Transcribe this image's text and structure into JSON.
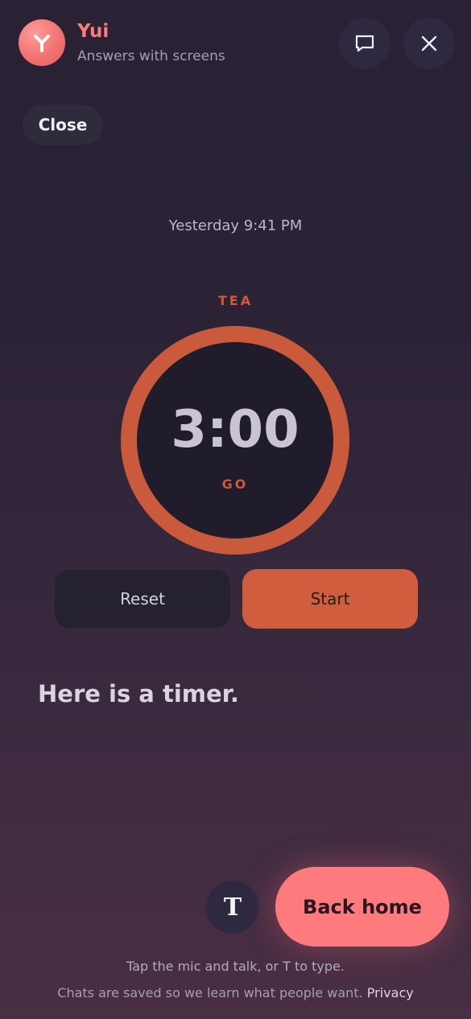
{
  "header": {
    "app_name": "Yui",
    "subtitle": "Answers with screens",
    "chat_icon": "chat-bubble-icon",
    "close_icon": "close-icon"
  },
  "close_label": "Close",
  "timestamp": "Yesterday 9:41 PM",
  "timer": {
    "label": "TEA",
    "time": "3:00",
    "status": "GO",
    "reset_label": "Reset",
    "start_label": "Start",
    "accent_color": "#c95a3c"
  },
  "message": "Here is a timer.",
  "bottom": {
    "type_button_label": "T",
    "back_home_label": "Back home",
    "hint": "Tap the mic and talk, or T to type.",
    "footer_text": "Chats are saved so we learn what people want.",
    "privacy_link": "Privacy",
    "brand_color": "#ff7a7c"
  }
}
